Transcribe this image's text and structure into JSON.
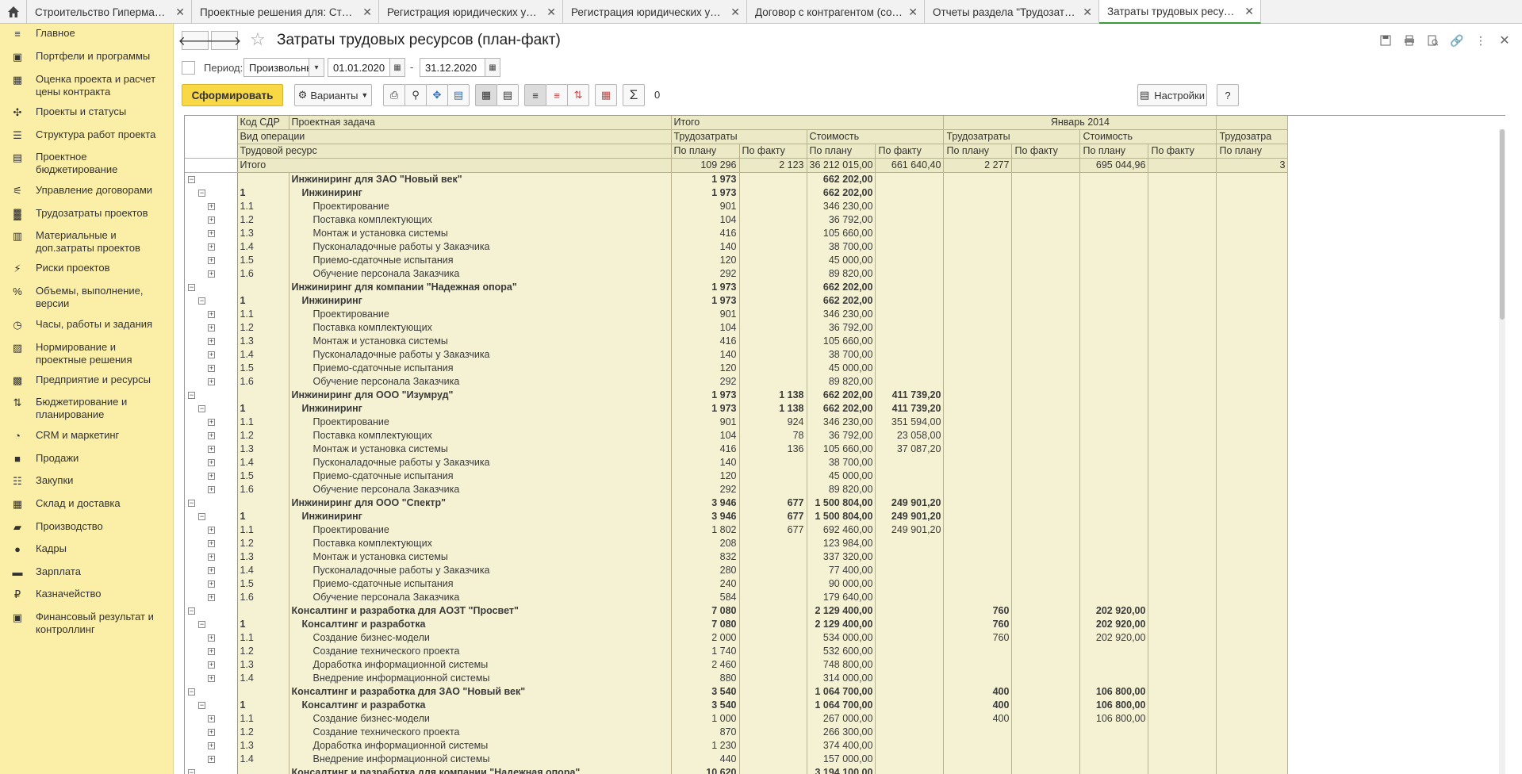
{
  "tabs": [
    {
      "label": "Строительство Гипермаркета (Проект)",
      "active": false
    },
    {
      "label": "Проектные решения для: Строительство Гипермаркета",
      "active": false
    },
    {
      "label": "Регистрация юридических условий договора",
      "active": false
    },
    {
      "label": "Регистрация юридических условий договора",
      "active": false
    },
    {
      "label": "Договор с контрагентом (создание) *",
      "active": false
    },
    {
      "label": "Отчеты раздела \"Трудозатраты проектов\"",
      "active": false
    },
    {
      "label": "Затраты трудовых ресурсов (план-факт)",
      "active": true
    }
  ],
  "sidebar": {
    "items": [
      {
        "label": "Главное",
        "icon": "menu-icon"
      },
      {
        "label": "Портфели и программы",
        "icon": "briefcase-icon"
      },
      {
        "label": "Оценка проекта и расчет цены контракта",
        "icon": "calculator-icon"
      },
      {
        "label": "Проекты и статусы",
        "icon": "status-icon"
      },
      {
        "label": "Структура работ проекта",
        "icon": "structure-icon"
      },
      {
        "label": "Проектное бюджетирование",
        "icon": "budget-icon"
      },
      {
        "label": "Управление договорами",
        "icon": "handshake-icon"
      },
      {
        "label": "Трудозатраты проектов",
        "icon": "labor-icon"
      },
      {
        "label": "Материальные и доп.затраты проектов",
        "icon": "materials-icon"
      },
      {
        "label": "Риски проектов",
        "icon": "risk-icon"
      },
      {
        "label": "Объемы, выполнение, версии",
        "icon": "percent-icon"
      },
      {
        "label": "Часы, работы и задания",
        "icon": "clock-icon"
      },
      {
        "label": "Нормирование и проектные решения",
        "icon": "norm-icon"
      },
      {
        "label": "Предприятие и ресурсы",
        "icon": "enterprise-icon"
      },
      {
        "label": "Бюджетирование и планирование",
        "icon": "planning-icon"
      },
      {
        "label": "CRM и маркетинг",
        "icon": "crm-icon"
      },
      {
        "label": "Продажи",
        "icon": "bag-icon"
      },
      {
        "label": "Закупки",
        "icon": "cart-icon"
      },
      {
        "label": "Склад и доставка",
        "icon": "warehouse-icon"
      },
      {
        "label": "Производство",
        "icon": "factory-icon"
      },
      {
        "label": "Кадры",
        "icon": "person-icon"
      },
      {
        "label": "Зарплата",
        "icon": "salary-icon"
      },
      {
        "label": "Казначейство",
        "icon": "ruble-icon"
      },
      {
        "label": "Финансовый результат и контроллинг",
        "icon": "finance-icon"
      }
    ]
  },
  "page": {
    "title": "Затраты трудовых ресурсов (план-факт)"
  },
  "period": {
    "label": "Период:",
    "mode": "Произвольный",
    "from": "01.01.2020",
    "dash": "-",
    "to": "31.12.2020"
  },
  "toolbar": {
    "generate_label": "Сформировать",
    "variants_label": "Варианты",
    "sum_value": "0",
    "settings_label": "Настройки",
    "help_label": "?"
  },
  "report": {
    "headers": {
      "col_code": "Код СДР",
      "col_task": "Проектная задача",
      "col_optype": "Вид операции",
      "col_resource": "Трудовой ресурс",
      "total_group": "Итого",
      "labor": "Трудозатраты",
      "cost": "Стоимость",
      "plan": "По плану",
      "fact": "По факту",
      "month1": "Январь 2014",
      "labor_cut": "Трудозатра"
    },
    "total": {
      "label": "Итого",
      "v": [
        "109 296",
        "2 123",
        "36 212 015,00",
        "661 640,40",
        "2 277",
        "",
        "695 044,96",
        "",
        "3"
      ]
    },
    "rows": [
      {
        "lvl": 0,
        "code": "",
        "name": "Инжиниринг для ЗАО \"Новый век\"",
        "v": [
          "1 973",
          "",
          "662 202,00",
          "",
          "",
          "",
          "",
          "",
          ""
        ]
      },
      {
        "lvl": 1,
        "code": "1",
        "name": "Инжиниринг",
        "v": [
          "1 973",
          "",
          "662 202,00",
          "",
          "",
          "",
          "",
          "",
          ""
        ]
      },
      {
        "lvl": 2,
        "code": "1.1",
        "name": "Проектирование",
        "v": [
          "901",
          "",
          "346 230,00",
          "",
          "",
          "",
          "",
          "",
          ""
        ]
      },
      {
        "lvl": 2,
        "code": "1.2",
        "name": "Поставка комплектующих",
        "v": [
          "104",
          "",
          "36 792,00",
          "",
          "",
          "",
          "",
          "",
          ""
        ]
      },
      {
        "lvl": 2,
        "code": "1.3",
        "name": "Монтаж и установка системы",
        "v": [
          "416",
          "",
          "105 660,00",
          "",
          "",
          "",
          "",
          "",
          ""
        ]
      },
      {
        "lvl": 2,
        "code": "1.4",
        "name": "Пусконаладочные работы у Заказчика",
        "v": [
          "140",
          "",
          "38 700,00",
          "",
          "",
          "",
          "",
          "",
          ""
        ]
      },
      {
        "lvl": 2,
        "code": "1.5",
        "name": "Приемо-сдаточные испытания",
        "v": [
          "120",
          "",
          "45 000,00",
          "",
          "",
          "",
          "",
          "",
          ""
        ]
      },
      {
        "lvl": 2,
        "code": "1.6",
        "name": "Обучение персонала Заказчика",
        "v": [
          "292",
          "",
          "89 820,00",
          "",
          "",
          "",
          "",
          "",
          ""
        ]
      },
      {
        "lvl": 0,
        "code": "",
        "name": "Инжиниринг для компании \"Надежная опора\"",
        "v": [
          "1 973",
          "",
          "662 202,00",
          "",
          "",
          "",
          "",
          "",
          ""
        ]
      },
      {
        "lvl": 1,
        "code": "1",
        "name": "Инжиниринг",
        "v": [
          "1 973",
          "",
          "662 202,00",
          "",
          "",
          "",
          "",
          "",
          ""
        ]
      },
      {
        "lvl": 2,
        "code": "1.1",
        "name": "Проектирование",
        "v": [
          "901",
          "",
          "346 230,00",
          "",
          "",
          "",
          "",
          "",
          ""
        ]
      },
      {
        "lvl": 2,
        "code": "1.2",
        "name": "Поставка комплектующих",
        "v": [
          "104",
          "",
          "36 792,00",
          "",
          "",
          "",
          "",
          "",
          ""
        ]
      },
      {
        "lvl": 2,
        "code": "1.3",
        "name": "Монтаж и установка системы",
        "v": [
          "416",
          "",
          "105 660,00",
          "",
          "",
          "",
          "",
          "",
          ""
        ]
      },
      {
        "lvl": 2,
        "code": "1.4",
        "name": "Пусконаладочные работы у Заказчика",
        "v": [
          "140",
          "",
          "38 700,00",
          "",
          "",
          "",
          "",
          "",
          ""
        ]
      },
      {
        "lvl": 2,
        "code": "1.5",
        "name": "Приемо-сдаточные испытания",
        "v": [
          "120",
          "",
          "45 000,00",
          "",
          "",
          "",
          "",
          "",
          ""
        ]
      },
      {
        "lvl": 2,
        "code": "1.6",
        "name": "Обучение персонала Заказчика",
        "v": [
          "292",
          "",
          "89 820,00",
          "",
          "",
          "",
          "",
          "",
          ""
        ]
      },
      {
        "lvl": 0,
        "code": "",
        "name": "Инжиниринг для ООО \"Изумруд\"",
        "v": [
          "1 973",
          "1 138",
          "662 202,00",
          "411 739,20",
          "",
          "",
          "",
          "",
          ""
        ]
      },
      {
        "lvl": 1,
        "code": "1",
        "name": "Инжиниринг",
        "v": [
          "1 973",
          "1 138",
          "662 202,00",
          "411 739,20",
          "",
          "",
          "",
          "",
          ""
        ]
      },
      {
        "lvl": 2,
        "code": "1.1",
        "name": "Проектирование",
        "v": [
          "901",
          "924",
          "346 230,00",
          "351 594,00",
          "",
          "",
          "",
          "",
          ""
        ]
      },
      {
        "lvl": 2,
        "code": "1.2",
        "name": "Поставка комплектующих",
        "v": [
          "104",
          "78",
          "36 792,00",
          "23 058,00",
          "",
          "",
          "",
          "",
          ""
        ]
      },
      {
        "lvl": 2,
        "code": "1.3",
        "name": "Монтаж и установка системы",
        "v": [
          "416",
          "136",
          "105 660,00",
          "37 087,20",
          "",
          "",
          "",
          "",
          ""
        ]
      },
      {
        "lvl": 2,
        "code": "1.4",
        "name": "Пусконаладочные работы у Заказчика",
        "v": [
          "140",
          "",
          "38 700,00",
          "",
          "",
          "",
          "",
          "",
          ""
        ]
      },
      {
        "lvl": 2,
        "code": "1.5",
        "name": "Приемо-сдаточные испытания",
        "v": [
          "120",
          "",
          "45 000,00",
          "",
          "",
          "",
          "",
          "",
          ""
        ]
      },
      {
        "lvl": 2,
        "code": "1.6",
        "name": "Обучение персонала Заказчика",
        "v": [
          "292",
          "",
          "89 820,00",
          "",
          "",
          "",
          "",
          "",
          ""
        ]
      },
      {
        "lvl": 0,
        "code": "",
        "name": "Инжиниринг для ООО \"Спектр\"",
        "v": [
          "3 946",
          "677",
          "1 500 804,00",
          "249 901,20",
          "",
          "",
          "",
          "",
          ""
        ]
      },
      {
        "lvl": 1,
        "code": "1",
        "name": "Инжиниринг",
        "v": [
          "3 946",
          "677",
          "1 500 804,00",
          "249 901,20",
          "",
          "",
          "",
          "",
          ""
        ]
      },
      {
        "lvl": 2,
        "code": "1.1",
        "name": "Проектирование",
        "v": [
          "1 802",
          "677",
          "692 460,00",
          "249 901,20",
          "",
          "",
          "",
          "",
          ""
        ]
      },
      {
        "lvl": 2,
        "code": "1.2",
        "name": "Поставка комплектующих",
        "v": [
          "208",
          "",
          "123 984,00",
          "",
          "",
          "",
          "",
          "",
          ""
        ]
      },
      {
        "lvl": 2,
        "code": "1.3",
        "name": "Монтаж и установка системы",
        "v": [
          "832",
          "",
          "337 320,00",
          "",
          "",
          "",
          "",
          "",
          ""
        ]
      },
      {
        "lvl": 2,
        "code": "1.4",
        "name": "Пусконаладочные работы у Заказчика",
        "v": [
          "280",
          "",
          "77 400,00",
          "",
          "",
          "",
          "",
          "",
          ""
        ]
      },
      {
        "lvl": 2,
        "code": "1.5",
        "name": "Приемо-сдаточные испытания",
        "v": [
          "240",
          "",
          "90 000,00",
          "",
          "",
          "",
          "",
          "",
          ""
        ]
      },
      {
        "lvl": 2,
        "code": "1.6",
        "name": "Обучение персонала Заказчика",
        "v": [
          "584",
          "",
          "179 640,00",
          "",
          "",
          "",
          "",
          "",
          ""
        ]
      },
      {
        "lvl": 0,
        "code": "",
        "name": "Консалтинг и разработка для АОЗТ \"Просвет\"",
        "v": [
          "7 080",
          "",
          "2 129 400,00",
          "",
          "760",
          "",
          "202 920,00",
          "",
          ""
        ]
      },
      {
        "lvl": 1,
        "code": "1",
        "name": "Консалтинг и разработка",
        "v": [
          "7 080",
          "",
          "2 129 400,00",
          "",
          "760",
          "",
          "202 920,00",
          "",
          ""
        ]
      },
      {
        "lvl": 2,
        "code": "1.1",
        "name": "Создание бизнес-модели",
        "v": [
          "2 000",
          "",
          "534 000,00",
          "",
          "760",
          "",
          "202 920,00",
          "",
          ""
        ]
      },
      {
        "lvl": 2,
        "code": "1.2",
        "name": "Создание технического проекта",
        "v": [
          "1 740",
          "",
          "532 600,00",
          "",
          "",
          "",
          "",
          "",
          ""
        ]
      },
      {
        "lvl": 2,
        "code": "1.3",
        "name": "Доработка информационной системы",
        "v": [
          "2 460",
          "",
          "748 800,00",
          "",
          "",
          "",
          "",
          "",
          ""
        ]
      },
      {
        "lvl": 2,
        "code": "1.4",
        "name": "Внедрение информационной системы",
        "v": [
          "880",
          "",
          "314 000,00",
          "",
          "",
          "",
          "",
          "",
          ""
        ]
      },
      {
        "lvl": 0,
        "code": "",
        "name": "Консалтинг и разработка для ЗАО \"Новый век\"",
        "v": [
          "3 540",
          "",
          "1 064 700,00",
          "",
          "400",
          "",
          "106 800,00",
          "",
          ""
        ]
      },
      {
        "lvl": 1,
        "code": "1",
        "name": "Консалтинг и разработка",
        "v": [
          "3 540",
          "",
          "1 064 700,00",
          "",
          "400",
          "",
          "106 800,00",
          "",
          ""
        ]
      },
      {
        "lvl": 2,
        "code": "1.1",
        "name": "Создание бизнес-модели",
        "v": [
          "1 000",
          "",
          "267 000,00",
          "",
          "400",
          "",
          "106 800,00",
          "",
          ""
        ]
      },
      {
        "lvl": 2,
        "code": "1.2",
        "name": "Создание технического проекта",
        "v": [
          "870",
          "",
          "266 300,00",
          "",
          "",
          "",
          "",
          "",
          ""
        ]
      },
      {
        "lvl": 2,
        "code": "1.3",
        "name": "Доработка информационной системы",
        "v": [
          "1 230",
          "",
          "374 400,00",
          "",
          "",
          "",
          "",
          "",
          ""
        ]
      },
      {
        "lvl": 2,
        "code": "1.4",
        "name": "Внедрение информационной системы",
        "v": [
          "440",
          "",
          "157 000,00",
          "",
          "",
          "",
          "",
          "",
          ""
        ]
      },
      {
        "lvl": 0,
        "code": "",
        "name": "Консалтинг и разработка для компании \"Надежная опора\"",
        "v": [
          "10 620",
          "",
          "3 194 100,00",
          "",
          "",
          "",
          "",
          "",
          ""
        ]
      }
    ]
  }
}
